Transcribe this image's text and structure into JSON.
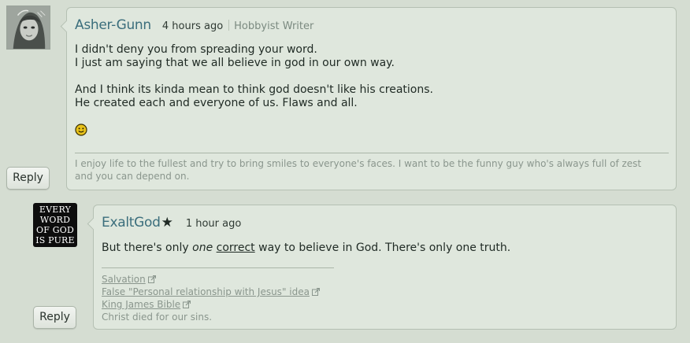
{
  "comments": [
    {
      "username": "Asher-Gunn",
      "timestamp": "4 hours ago",
      "role": "Hobbyist Writer",
      "body_lines": [
        "I didn't deny you from spreading your word.",
        "I just am saying that we all believe in god in our own way.",
        "",
        "And I think its kinda mean to think god doesn't like his creations.",
        "He created each and everyone of us. Flaws and all."
      ],
      "emoticon": "smiley-icon",
      "signature": "I enjoy life to the fullest and try to bring smiles to everyone's faces. I want to be the funny guy who's always full of zest and you can depend on.",
      "reply_label": "Reply"
    },
    {
      "username": "ExaltGod",
      "badge": "★",
      "timestamp": "1 hour ago",
      "body": {
        "pre": "But there's only ",
        "emphasis": "one",
        "mid": " ",
        "underlined": "correct",
        "post": " way to believe in God.  There's only one truth."
      },
      "avatar_text": [
        "EVERY",
        "WORD",
        "OF GOD",
        "IS PURE"
      ],
      "signature_links": [
        "Salvation",
        "False \"Personal relationship with Jesus\" idea",
        "King James Bible"
      ],
      "signature_text": "Christ died for our sins.",
      "reply_label": "Reply"
    }
  ],
  "colors": {
    "background": "#d5ddd2",
    "card": "#dfe7dd",
    "username": "#3b6e7c",
    "muted": "#8a968d"
  }
}
